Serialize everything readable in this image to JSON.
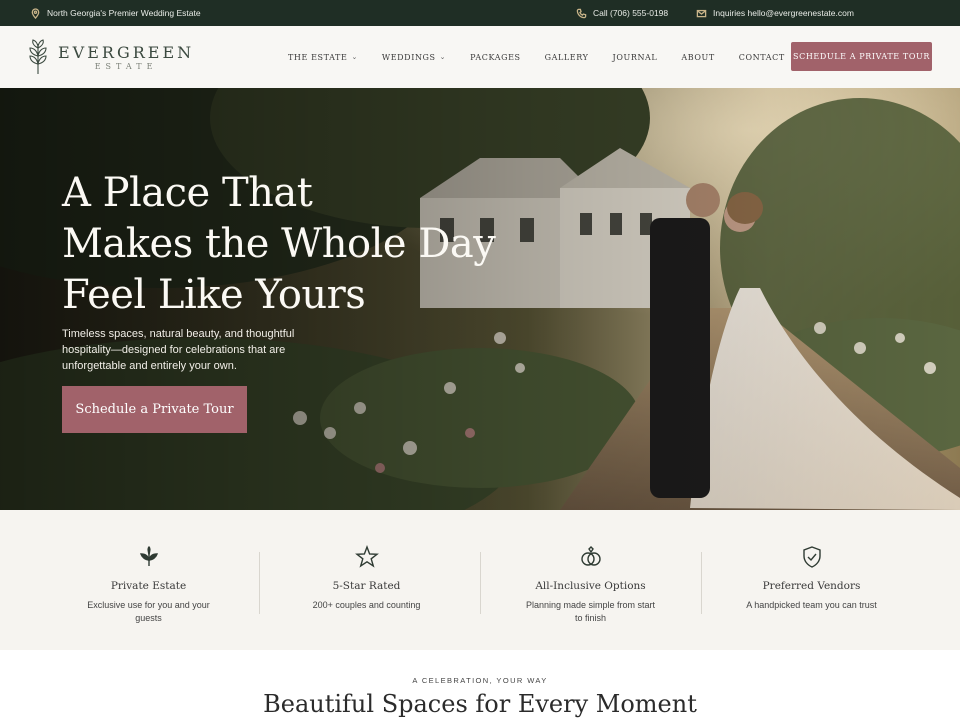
{
  "topbar": {
    "tagline": "North Georgia's Premier Wedding Estate",
    "phone": "Call (706) 555-0198",
    "email": "Inquiries hello@evergreenestate.com"
  },
  "logo": {
    "name": "EVERGREEN",
    "sub": "ESTATE"
  },
  "nav": {
    "items": [
      "THE ESTATE",
      "WEDDINGS",
      "PACKAGES",
      "GALLERY",
      "JOURNAL",
      "ABOUT",
      "CONTACT"
    ],
    "cta": "SCHEDULE A PRIVATE TOUR"
  },
  "hero": {
    "title_lines": [
      "A Place That",
      "Makes the Whole Day",
      "Feel Like Yours"
    ],
    "subtitle": "Timeless spaces, natural beauty, and thoughtful hospitality—designed for celebrations that are unforgettable and entirely your own.",
    "button": "Schedule a Private Tour"
  },
  "features": [
    {
      "icon": "leaf-icon",
      "title": "Private Estate",
      "desc": "Exclusive use for you and your guests"
    },
    {
      "icon": "star-icon",
      "title": "5-Star Rated",
      "desc": "200+ couples and counting"
    },
    {
      "icon": "rings-icon",
      "title": "All-Inclusive Options",
      "desc": "Planning made simple from start to finish"
    },
    {
      "icon": "shield-check-icon",
      "title": "Preferred Vendors",
      "desc": "A handpicked team you can trust"
    }
  ],
  "section": {
    "eyebrow": "A CELEBRATION, YOUR WAY",
    "title": "Beautiful Spaces for Every Moment"
  },
  "colors": {
    "topbar_bg": "#1f2e25",
    "accent": "#a1626a",
    "gold": "#c9b58a"
  }
}
